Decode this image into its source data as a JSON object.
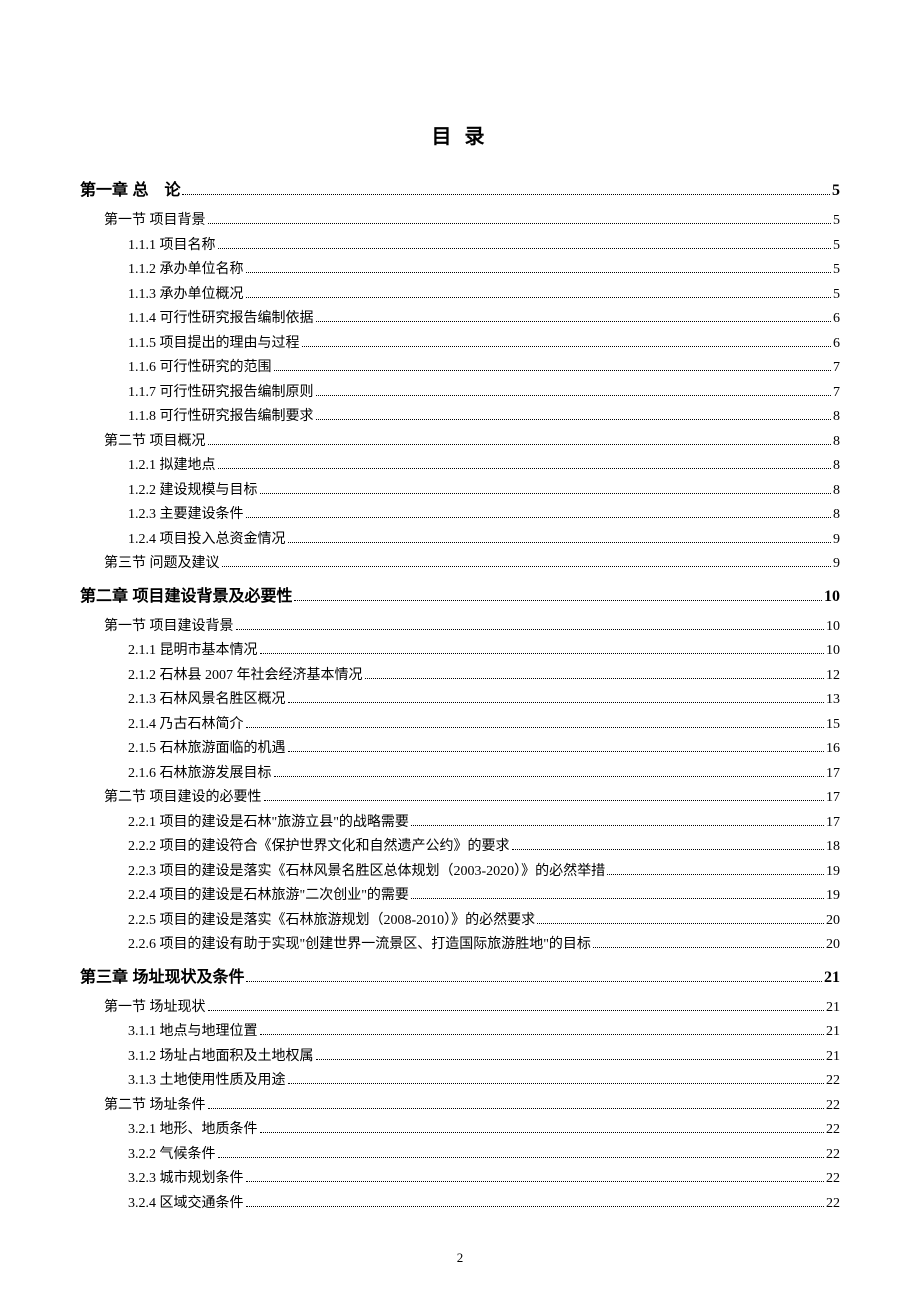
{
  "title": "目 录",
  "page_number": "2",
  "toc": [
    {
      "level": 1,
      "label": "第一章 总　论",
      "page": "5"
    },
    {
      "level": 2,
      "label": "第一节  项目背景",
      "page": "5"
    },
    {
      "level": 3,
      "label": "1.1.1  项目名称",
      "page": "5"
    },
    {
      "level": 3,
      "label": "1.1.2  承办单位名称",
      "page": "5"
    },
    {
      "level": 3,
      "label": "1.1.3  承办单位概况",
      "page": "5"
    },
    {
      "level": 3,
      "label": "1.1.4 可行性研究报告编制依据",
      "page": "6"
    },
    {
      "level": 3,
      "label": "1.1.5  项目提出的理由与过程",
      "page": "6"
    },
    {
      "level": 3,
      "label": "1.1.6  可行性研究的范围",
      "page": "7"
    },
    {
      "level": 3,
      "label": "1.1.7  可行性研究报告编制原则",
      "page": "7"
    },
    {
      "level": 3,
      "label": "1.1.8  可行性研究报告编制要求",
      "page": "8"
    },
    {
      "level": 2,
      "label": "第二节  项目概况",
      "page": "8"
    },
    {
      "level": 3,
      "label": "1.2.1  拟建地点",
      "page": "8"
    },
    {
      "level": 3,
      "label": "1.2.2  建设规模与目标",
      "page": "8"
    },
    {
      "level": 3,
      "label": "1.2.3  主要建设条件",
      "page": "8"
    },
    {
      "level": 3,
      "label": "1.2.4  项目投入总资金情况",
      "page": "9"
    },
    {
      "level": 2,
      "label": "第三节 问题及建议",
      "page": "9"
    },
    {
      "level": 1,
      "label": "第二章  项目建设背景及必要性",
      "page": "10"
    },
    {
      "level": 2,
      "label": "第一节  项目建设背景",
      "page": "10"
    },
    {
      "level": 3,
      "label": "2.1.1  昆明市基本情况",
      "page": "10"
    },
    {
      "level": 3,
      "label": "2.1.2  石林县 2007 年社会经济基本情况",
      "page": "12"
    },
    {
      "level": 3,
      "label": "2.1.3  石林风景名胜区概况",
      "page": "13"
    },
    {
      "level": 3,
      "label": "2.1.4 乃古石林简介",
      "page": "15"
    },
    {
      "level": 3,
      "label": "2.1.5 石林旅游面临的机遇",
      "page": "16"
    },
    {
      "level": 3,
      "label": "2.1.6 石林旅游发展目标",
      "page": "17"
    },
    {
      "level": 2,
      "label": "第二节  项目建设的必要性",
      "page": "17"
    },
    {
      "level": 3,
      "label": "2.2.1 项目的建设是石林\"旅游立县\"的战略需要",
      "page": "17"
    },
    {
      "level": 3,
      "label": "2.2.2 项目的建设符合《保护世界文化和自然遗产公约》的要求",
      "page": "18"
    },
    {
      "level": 3,
      "label": "2.2.3 项目的建设是落实《石林风景名胜区总体规划（2003-2020）》的必然举措",
      "page": "19"
    },
    {
      "level": 3,
      "label": "2.2.4 项目的建设是石林旅游\"二次创业\"的需要",
      "page": "19"
    },
    {
      "level": 3,
      "label": "2.2.5 项目的建设是落实《石林旅游规划（2008-2010）》的必然要求",
      "page": "20"
    },
    {
      "level": 3,
      "label": "2.2.6 项目的建设有助于实现\"创建世界一流景区、打造国际旅游胜地\"的目标",
      "page": "20"
    },
    {
      "level": 1,
      "label": "第三章  场址现状及条件",
      "page": "21"
    },
    {
      "level": 2,
      "label": "第一节  场址现状",
      "page": "21"
    },
    {
      "level": 3,
      "label": "3.1.1  地点与地理位置",
      "page": "21"
    },
    {
      "level": 3,
      "label": "3.1.2  场址占地面积及土地权属",
      "page": "21"
    },
    {
      "level": 3,
      "label": "3.1.3 土地使用性质及用途",
      "page": "22"
    },
    {
      "level": 2,
      "label": "第二节 场址条件",
      "page": "22"
    },
    {
      "level": 3,
      "label": "3.2.1  地形、地质条件",
      "page": "22"
    },
    {
      "level": 3,
      "label": "3.2.2  气候条件",
      "page": "22"
    },
    {
      "level": 3,
      "label": "3.2.3  城市规划条件",
      "page": "22"
    },
    {
      "level": 3,
      "label": "3.2.4  区域交通条件",
      "page": "22"
    }
  ]
}
